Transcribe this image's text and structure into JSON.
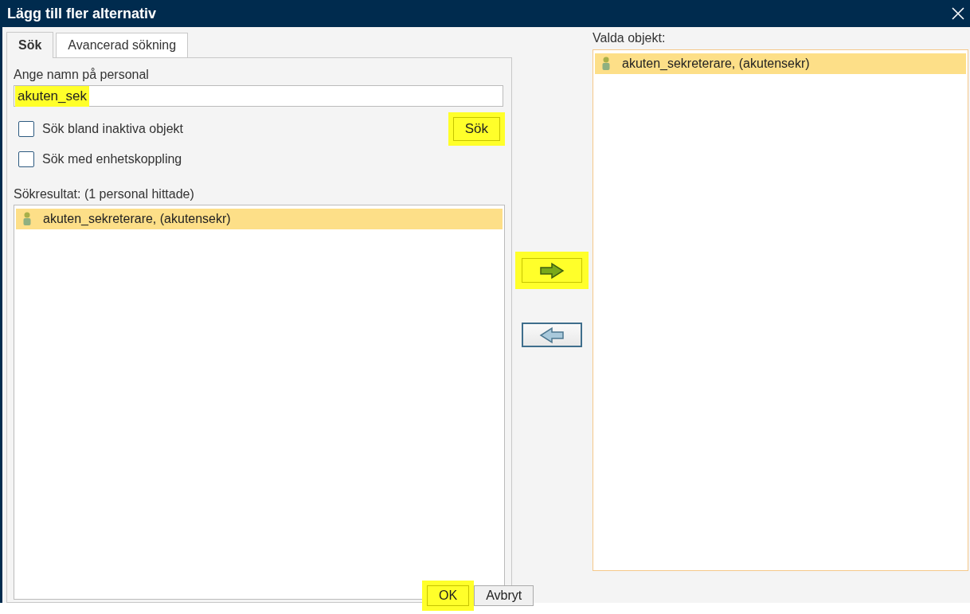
{
  "window": {
    "title": "Lägg till fler alternativ"
  },
  "tabs": [
    {
      "label": "Sök",
      "selected": true
    },
    {
      "label": "Avancerad sökning",
      "selected": false
    }
  ],
  "name_field": {
    "label": "Ange namn på personal",
    "value": "akuten_sek",
    "highlighted": true
  },
  "options": [
    {
      "label": "Sök bland inaktiva objekt",
      "checked": false
    },
    {
      "label": "Sök med enhetskoppling",
      "checked": false
    }
  ],
  "search_button": {
    "label": "Sök",
    "highlighted": true
  },
  "results": {
    "label": "Sökresultat: (1 personal hittade)",
    "items": [
      {
        "name": "akuten_sekreterare, (akutensekr)",
        "selected": true
      }
    ]
  },
  "transfer_buttons": [
    {
      "kind": "add",
      "highlighted": true
    },
    {
      "kind": "remove",
      "highlighted": false
    }
  ],
  "selected_objects": {
    "label": "Valda objekt:",
    "items": [
      {
        "name": "akuten_sekreterare, (akutensekr)",
        "selected": true
      }
    ]
  },
  "footer_buttons": [
    {
      "label": "OK",
      "highlighted": true
    },
    {
      "label": "Avbryt",
      "highlighted": false
    }
  ]
}
